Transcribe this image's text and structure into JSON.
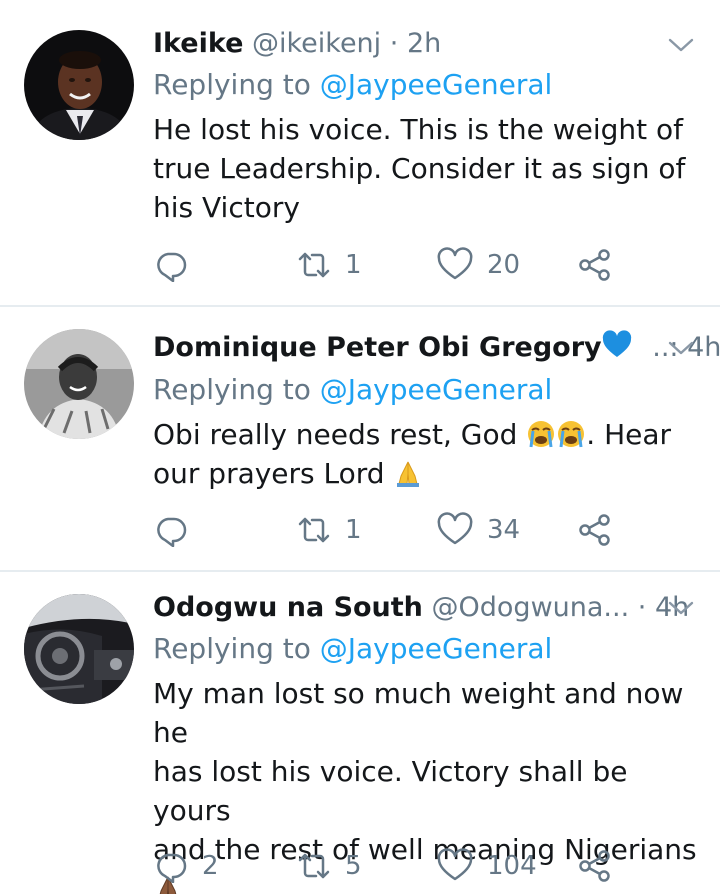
{
  "tweets": [
    {
      "name": "Ikeike",
      "handle": "@ikeikenj",
      "sep": "·",
      "time": "2h",
      "replying_prefix": "Replying to",
      "replying_to": "@JaypeeGeneral",
      "text_lines": [
        "He lost his voice. This is the weight of",
        "true Leadership. Consider it as sign of",
        "his Victory"
      ],
      "reply_count": "",
      "retweet_count": "1",
      "like_count": "20"
    },
    {
      "name": "Dominique Peter Obi Gregory",
      "handle": "",
      "sep": "..: ",
      "time": "4h",
      "replying_prefix": "Replying to",
      "replying_to": "@JaypeeGeneral",
      "text_line1": "Obi really needs rest, God ",
      "text_line1_after": ". Hear",
      "text_line2": "our prayers Lord ",
      "reply_count": "",
      "retweet_count": "1",
      "like_count": "34"
    },
    {
      "name": "Odogwu na South",
      "handle": "@Odogwuna...",
      "sep": "·",
      "time": "4h",
      "replying_prefix": "Replying to",
      "replying_to": "@JaypeeGeneral",
      "text_lines": [
        "My man lost so much weight and now he",
        "has lost his voice. Victory shall be yours",
        "and the rest of well meaning Nigerians"
      ],
      "reply_count": "2",
      "retweet_count": "5",
      "like_count": "104"
    }
  ],
  "icons": {
    "reply": "reply-icon",
    "retweet": "retweet-icon",
    "like": "heart-icon",
    "share": "share-icon",
    "more": "chevron-down-icon",
    "blue_heart": "blue-heart-emoji",
    "crying": "loudly-crying-face-emoji",
    "pray": "folded-hands-emoji"
  },
  "colors": {
    "text": "#14171a",
    "secondary": "#657786",
    "link": "#1da1f2",
    "divider": "#e6ecf0"
  }
}
